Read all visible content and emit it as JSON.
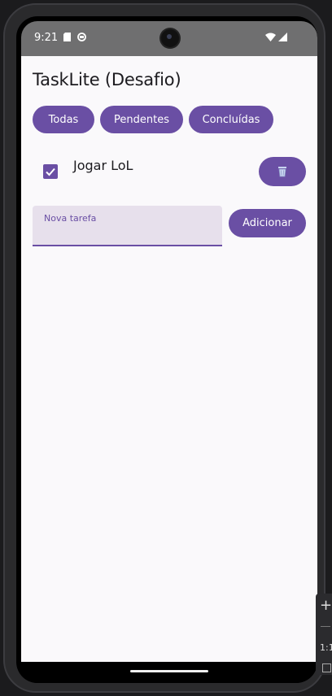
{
  "status_bar": {
    "time": "9:21"
  },
  "app": {
    "title": "TaskLite (Desafio)"
  },
  "filters": {
    "all_label": "Todas",
    "pending_label": "Pendentes",
    "done_label": "Concluídas"
  },
  "tasks": [
    {
      "title": "Jogar LoL",
      "completed": true
    }
  ],
  "new_task": {
    "label": "Nova tarefa",
    "value": "",
    "add_label": "Adicionar"
  },
  "emulator_toolbar": {
    "zoom_in_symbol": "+",
    "ratio_label": "1:1"
  },
  "colors": {
    "primary": "#6a4fa4",
    "background": "#faf9fb",
    "input_background": "#e7e0ec",
    "status_bar": "#6f6f70"
  }
}
